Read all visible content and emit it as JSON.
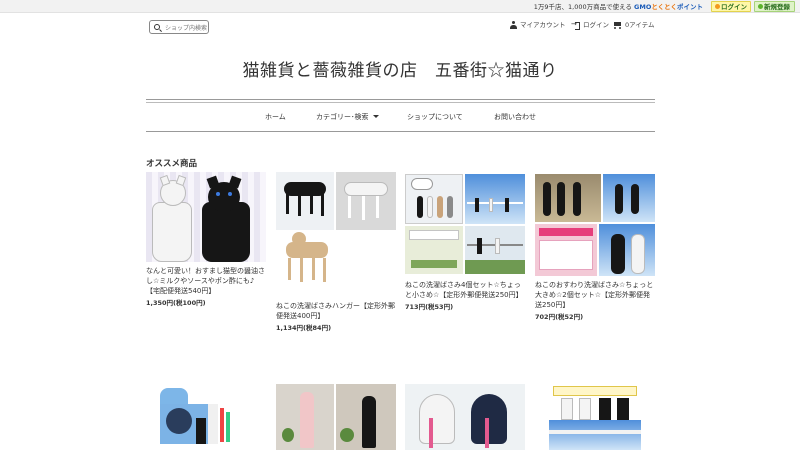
{
  "topbar": {
    "promo_prefix": "1万9千店、1,000万商品で使える",
    "promo_brand": "GMO",
    "promo_brand_sub": "とくとく",
    "promo_point": "ポイント",
    "login_label": "ログイン",
    "signup_label": "新規登録"
  },
  "header": {
    "search_placeholder": "ショップ内検索",
    "account_label": "マイアカウント",
    "login_label": "ログイン",
    "cart_label": "0アイテム",
    "shop_title": "猫雑貨と薔薇雑貨の店　五番街☆猫通り"
  },
  "nav": {
    "home": "ホーム",
    "category": "カテゴリー･検索",
    "about": "ショップについて",
    "contact": "お問い合わせ"
  },
  "section": {
    "title": "オススメ商品"
  },
  "products": [
    {
      "name": "なんと可愛い！おすまし猫型の醤油さし☆ミルクやソースやポン酢にも♪【宅配便発送540円】",
      "price": "1,350円(税100円)"
    },
    {
      "name": "ねこの洗濯ばさみハンガー【定形外郵便発送400円】",
      "price": "1,134円(税84円)"
    },
    {
      "name": "ねこの洗濯ばさみ4個セット☆ちょっと小さめ☆【定形外郵便発送250円】",
      "price": "713円(税53円)"
    },
    {
      "name": "ねこのおすわり洗濯ばさみ☆ちょっと大きめ☆2個セット☆【定形外郵便発送250円】",
      "price": "702円(税52円)"
    }
  ]
}
